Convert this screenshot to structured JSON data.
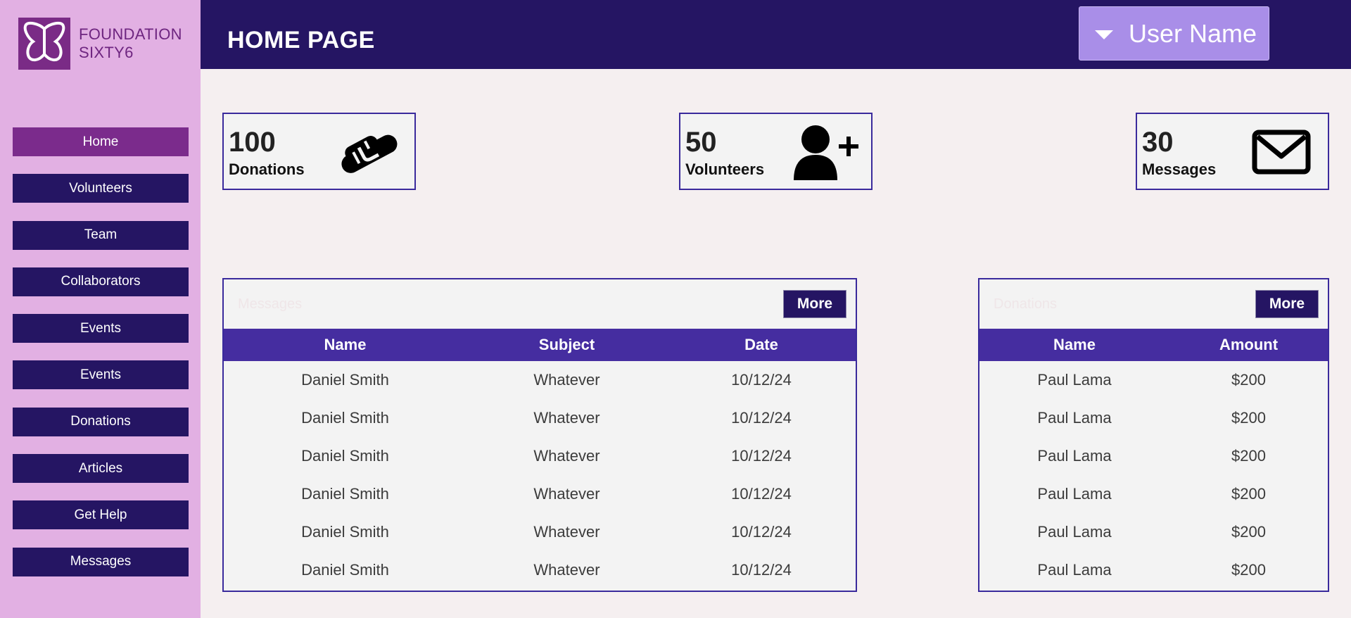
{
  "brand": {
    "line1": "FOUNDATION",
    "line2": "SIXTY6"
  },
  "sidebar": {
    "items": [
      {
        "label": "Home",
        "active": true
      },
      {
        "label": "Volunteers"
      },
      {
        "label": "Team"
      },
      {
        "label": "Collaborators"
      },
      {
        "label": "Events"
      },
      {
        "label": "Events"
      },
      {
        "label": "Donations"
      },
      {
        "label": "Articles"
      },
      {
        "label": "Get Help"
      },
      {
        "label": "Messages"
      }
    ]
  },
  "header": {
    "title": "HOME PAGE",
    "user_label": "User Name"
  },
  "stats": [
    {
      "value": "100",
      "label": "Donations",
      "icon": "handshake-icon"
    },
    {
      "value": "50",
      "label": "Volunteers",
      "icon": "add-user-icon"
    },
    {
      "value": "30",
      "label": "Messages",
      "icon": "envelope-icon"
    }
  ],
  "messages_panel": {
    "title": "Messages",
    "more_label": "More",
    "columns": [
      "Name",
      "Subject",
      "Date"
    ],
    "rows": [
      [
        "Daniel Smith",
        "Whatever",
        "10/12/24"
      ],
      [
        "Daniel Smith",
        "Whatever",
        "10/12/24"
      ],
      [
        "Daniel Smith",
        "Whatever",
        "10/12/24"
      ],
      [
        "Daniel Smith",
        "Whatever",
        "10/12/24"
      ],
      [
        "Daniel Smith",
        "Whatever",
        "10/12/24"
      ],
      [
        "Daniel Smith",
        "Whatever",
        "10/12/24"
      ]
    ]
  },
  "donations_panel": {
    "title": "Donations",
    "more_label": "More",
    "columns": [
      "Name",
      "Amount"
    ],
    "rows": [
      [
        "Paul Lama",
        "$200"
      ],
      [
        "Paul Lama",
        "$200"
      ],
      [
        "Paul Lama",
        "$200"
      ],
      [
        "Paul Lama",
        "$200"
      ],
      [
        "Paul Lama",
        "$200"
      ],
      [
        "Paul Lama",
        "$200"
      ]
    ]
  },
  "colors": {
    "sidebar_bg": "#e2b0e3",
    "nav_bg": "#251563",
    "nav_active": "#7b2b8c",
    "header_bg": "#251563",
    "table_header": "#452da0",
    "user_button": "#a98ee8"
  }
}
